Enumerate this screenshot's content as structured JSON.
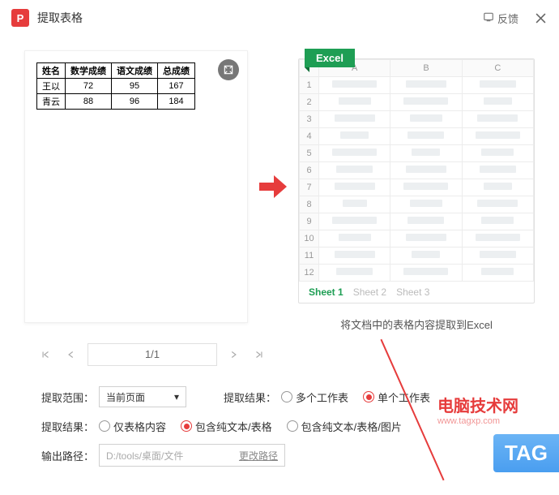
{
  "title": "提取表格",
  "feedback": "反馈",
  "chart_data": {
    "type": "table",
    "headers": [
      "姓名",
      "数学成绩",
      "语文成绩",
      "总成绩"
    ],
    "rows": [
      [
        "王以",
        "72",
        "95",
        "167"
      ],
      [
        "青云",
        "88",
        "96",
        "184"
      ]
    ]
  },
  "excel": {
    "badge": "Excel",
    "cols": [
      "A",
      "B",
      "C"
    ],
    "rowcount": 12,
    "tabs": [
      "Sheet 1",
      "Sheet 2",
      "Sheet 3"
    ],
    "active_tab": 0,
    "caption": "将文档中的表格内容提取到Excel"
  },
  "pager": {
    "text": "1/1"
  },
  "range": {
    "label": "提取范围：",
    "value": "当前页面",
    "result_label": "提取结果：",
    "opts": [
      "多个工作表",
      "单个工作表"
    ],
    "selected": 1
  },
  "result": {
    "label": "提取结果：",
    "opts": [
      "仅表格内容",
      "包含纯文本/表格",
      "包含纯文本/表格/图片"
    ],
    "selected": 1
  },
  "output": {
    "label": "输出路径：",
    "path": "D:/tools/桌面/文件",
    "change": "更改路径"
  },
  "watermark": "电脑技术网",
  "watermark_url": "www.tagxp.com",
  "tag": "TAG"
}
